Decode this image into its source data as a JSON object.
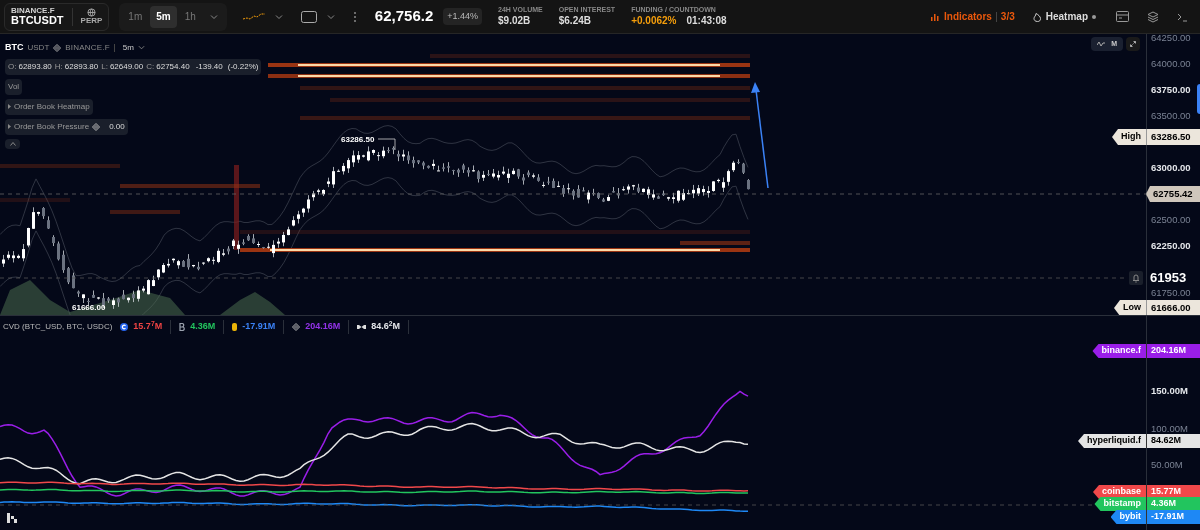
{
  "top_bar": {
    "exchange": "BINANCE.F",
    "symbol": "BTCUSDT",
    "contract": "PERP",
    "timeframes": [
      {
        "label": "1m",
        "selected": false
      },
      {
        "label": "5m",
        "selected": true
      },
      {
        "label": "1h",
        "selected": false
      }
    ],
    "price": "62,756.2",
    "change": "+1.44%",
    "stats": [
      {
        "label": "24H VOLUME",
        "value": "$9.02B",
        "kind": "plain"
      },
      {
        "label": "OPEN INTEREST",
        "value": "$6.24B",
        "kind": "plain"
      },
      {
        "label": "FUNDING / COUNTDOWN",
        "value": "+0.0062%",
        "extra": "01:43:08",
        "kind": "funding"
      }
    ],
    "indicators": {
      "label": "Indicators",
      "count": "3/3"
    },
    "heatmap": {
      "label": "Heatmap"
    }
  },
  "chart": {
    "base": "BTC",
    "quote": "USDT",
    "exchange": "BINANCE.F",
    "timeframe": "5m",
    "ohlc": [
      {
        "label": "O:",
        "value": "62893.80"
      },
      {
        "label": "H:",
        "value": "62893.80"
      },
      {
        "label": "L:",
        "value": "62649.00"
      },
      {
        "label": "C:",
        "value": "62754.40"
      }
    ],
    "change": "-139.40",
    "change_pct": "(-0.22%)",
    "overlays": [
      {
        "label": "Vol",
        "kind": "plain"
      },
      {
        "label": "Order Book Heatmap",
        "kind": "toggle"
      },
      {
        "label": "Order Book Pressure",
        "kind": "value",
        "value": "0.00"
      }
    ],
    "mode_button": "M",
    "high_annotation": "63286.50",
    "low_annotation": "61666.00",
    "price_ticks": [
      {
        "label": "64250.00",
        "emphasized": false
      },
      {
        "label": "64000.00",
        "emphasized": false
      },
      {
        "label": "63750.00",
        "emphasized": true
      },
      {
        "label": "63500.00",
        "emphasized": false
      },
      {
        "label": "63000.00",
        "emphasized": true
      },
      {
        "label": "62500.00",
        "emphasized": false
      },
      {
        "label": "62250.00",
        "emphasized": true
      },
      {
        "label": "61750.00",
        "emphasized": false
      }
    ],
    "price_markers": [
      {
        "kind": "high",
        "label": "High",
        "value": "63286.50"
      },
      {
        "kind": "current",
        "value": "62755.42"
      },
      {
        "kind": "alert",
        "value": "61953"
      },
      {
        "kind": "low",
        "label": "Low",
        "value": "61666.00"
      }
    ]
  },
  "cvd": {
    "title": "CVD (BTC_USD, BTC, USDC)",
    "legend": [
      {
        "kind": "coinbase",
        "value": "15.7$^{7}$M",
        "color": "#ef4444"
      },
      {
        "kind": "bitstamp",
        "value": "4.36M",
        "color": "#22c55e"
      },
      {
        "kind": "bybit",
        "value": "-17.91M",
        "color": "#3b82f6"
      },
      {
        "kind": "binance",
        "value": "204.16M",
        "color": "#9333ea"
      },
      {
        "kind": "hyperliquid",
        "value": "84.6$^{2}$M",
        "color": "#e5e7eb"
      }
    ],
    "ticks": [
      {
        "label": "150.00M",
        "emphasized": true
      },
      {
        "label": "100.00M",
        "emphasized": false
      },
      {
        "label": "50.00M",
        "emphasized": false
      }
    ],
    "series_labels": [
      {
        "name": "binance.f",
        "value": "204.16M",
        "color": "#9a1ee8"
      },
      {
        "name": "hyperliquid.f",
        "value": "84.62M",
        "color": "#e5e5e5"
      },
      {
        "name": "coinbase",
        "value": "15.77M",
        "color": "#f0484a"
      },
      {
        "name": "bitstamp",
        "value": "4.36M",
        "color": "#22c55e"
      },
      {
        "name": "bybit",
        "value": "-17.91M",
        "color": "#1e88f5"
      }
    ]
  }
}
